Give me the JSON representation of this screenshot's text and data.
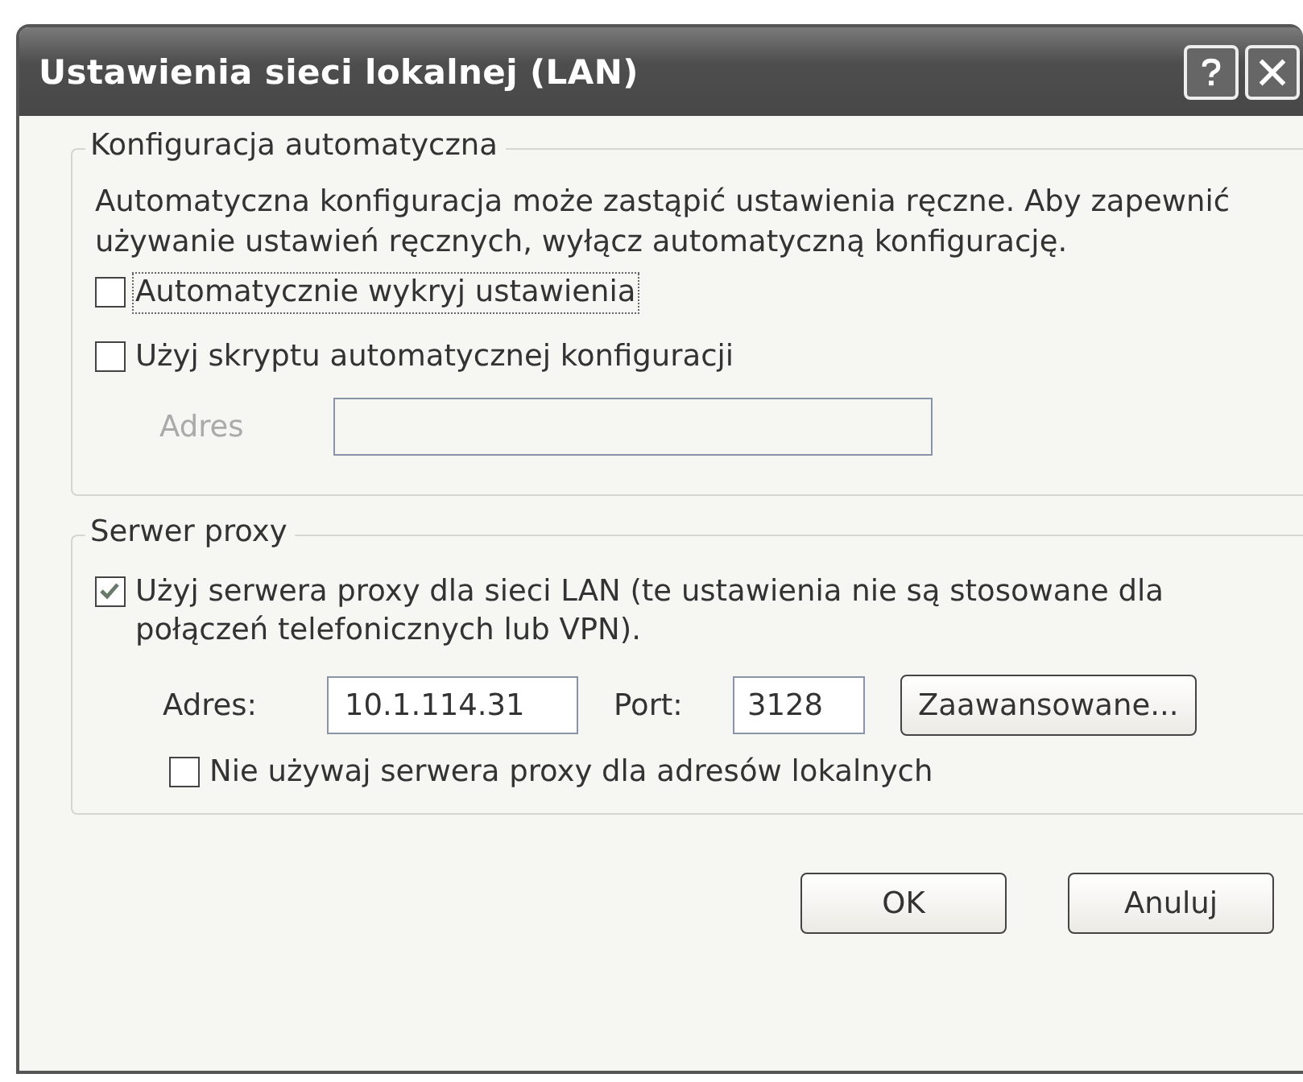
{
  "window": {
    "title": "Ustawienia sieci lokalnej (LAN)"
  },
  "auto_config": {
    "legend": "Konfiguracja automatyczna",
    "description": "Automatyczna konfiguracja może zastąpić ustawienia ręczne. Aby zapewnić używanie ustawień ręcznych, wyłącz automatyczną konfigurację.",
    "options": [
      {
        "label": "Automatycznie wykryj ustawienia",
        "checked": false,
        "focused": true
      },
      {
        "label": "Użyj skryptu automatycznej konfiguracji",
        "checked": false,
        "focused": false
      }
    ],
    "address": {
      "label": "Adres",
      "disabled": true
    }
  },
  "proxy": {
    "legend": "Serwer proxy",
    "use_proxy": {
      "label": "Użyj serwera proxy dla sieci LAN (te ustawienia nie są stosowane dla połączeń telefonicznych lub VPN).",
      "checked": true
    },
    "address": {
      "label": "Adres:",
      "value": "10.1.114.31"
    },
    "port": {
      "label": "Port:",
      "value": "3128"
    },
    "advanced_button": "Zaawansowane...",
    "bypass_local": {
      "label": "Nie używaj serwera proxy dla adresów lokalnych",
      "checked": false
    }
  },
  "buttons": [
    "OK",
    "Anuluj"
  ]
}
